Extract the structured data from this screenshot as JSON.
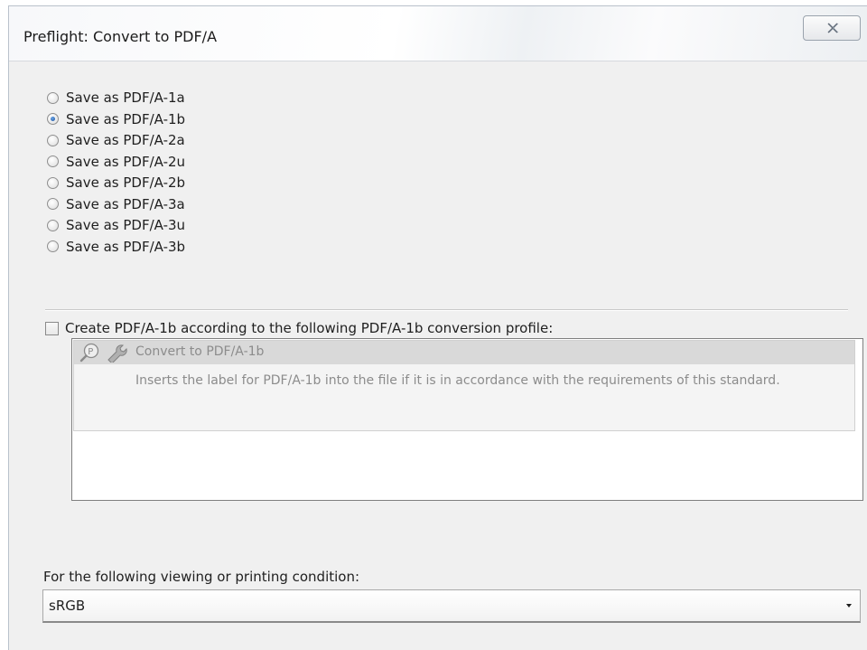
{
  "window": {
    "title": "Preflight: Convert to PDF/A",
    "close_icon": "close-x-icon"
  },
  "conformance_options": [
    {
      "label": "Save as PDF/A-1a",
      "selected": false
    },
    {
      "label": "Save as PDF/A-1b",
      "selected": true
    },
    {
      "label": "Save as PDF/A-2a",
      "selected": false
    },
    {
      "label": "Save as PDF/A-2u",
      "selected": false
    },
    {
      "label": "Save as PDF/A-2b",
      "selected": false
    },
    {
      "label": "Save as PDF/A-3a",
      "selected": false
    },
    {
      "label": "Save as PDF/A-3u",
      "selected": false
    },
    {
      "label": "Save as PDF/A-3b",
      "selected": false
    }
  ],
  "profile_option": {
    "label": "Create PDF/A-1b according to the following PDF/A-1b conversion profile:",
    "checked": false
  },
  "profiles": [
    {
      "name": "Convert to PDF/A-1b",
      "description": "Inserts the label for PDF/A-1b into the file if it is in accordance with the requirements of this standard.",
      "icons": [
        "preflight-search-icon",
        "wrench-fixup-icon"
      ]
    }
  ],
  "condition": {
    "label": "For the following viewing or printing condition:",
    "value": "sRGB"
  }
}
